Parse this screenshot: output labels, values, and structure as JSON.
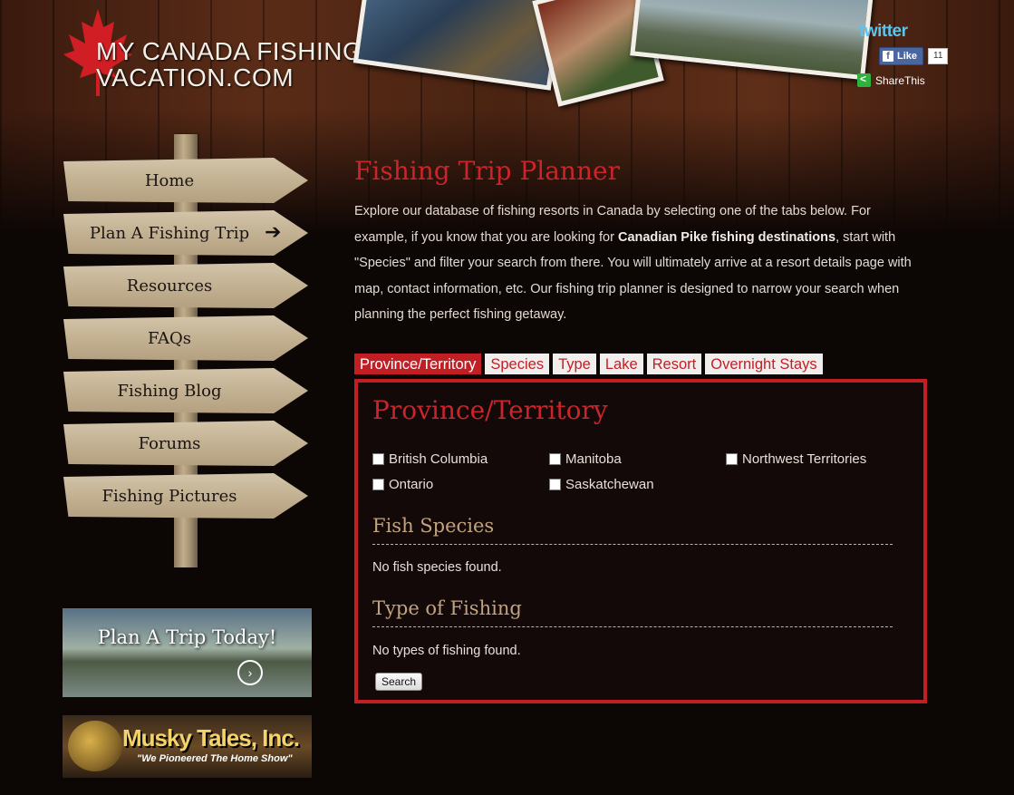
{
  "header": {
    "logo_line1": "MY CANADA FISHING",
    "logo_line2": "VACATION.COM",
    "twitter_label": "twitter",
    "fb_like_label": "Like",
    "fb_like_count": "11",
    "sharethis_label": "ShareThis"
  },
  "nav": {
    "items": [
      {
        "label": "Home"
      },
      {
        "label": "Plan A Fishing Trip"
      },
      {
        "label": "Resources"
      },
      {
        "label": "FAQs"
      },
      {
        "label": "Fishing Blog"
      },
      {
        "label": "Forums"
      },
      {
        "label": "Fishing Pictures"
      }
    ]
  },
  "banners": {
    "plan_trip": "Plan A Trip Today!",
    "musky_title": "Musky Tales, Inc.",
    "musky_tagline": "\"We Pioneered The Home Show\""
  },
  "main": {
    "title": "Fishing Trip Planner",
    "intro_part1": "Explore our database of fishing resorts in Canada by selecting one of the tabs below. For example, if you know that you are looking for ",
    "intro_bold": "Canadian Pike fishing destinations",
    "intro_part2": ", start with \"Species\" and filter your search from there. You will ultimately arrive at a resort details page with map, contact information, etc.  Our fishing trip planner is designed to narrow your search when planning the perfect fishing getaway.",
    "tabs": [
      {
        "label": "Province/Territory",
        "active": true
      },
      {
        "label": "Species"
      },
      {
        "label": "Type"
      },
      {
        "label": "Lake"
      },
      {
        "label": "Resort"
      },
      {
        "label": "Overnight Stays"
      }
    ],
    "panel": {
      "heading": "Province/Territory",
      "provinces": [
        {
          "label": "British Columbia",
          "checked": false
        },
        {
          "label": "Manitoba",
          "checked": false
        },
        {
          "label": "Northwest Territories",
          "checked": false
        },
        {
          "label": "Ontario",
          "checked": false
        },
        {
          "label": "Saskatchewan",
          "checked": false
        }
      ],
      "species_heading": "Fish Species",
      "species_message": "No fish species found.",
      "type_heading": "Type of Fishing",
      "type_message": "No types of fishing found.",
      "search_label": "Search"
    }
  },
  "colors": {
    "accent_red": "#c21f25",
    "section_tan": "#c3a37e",
    "background": "#0c0605"
  }
}
